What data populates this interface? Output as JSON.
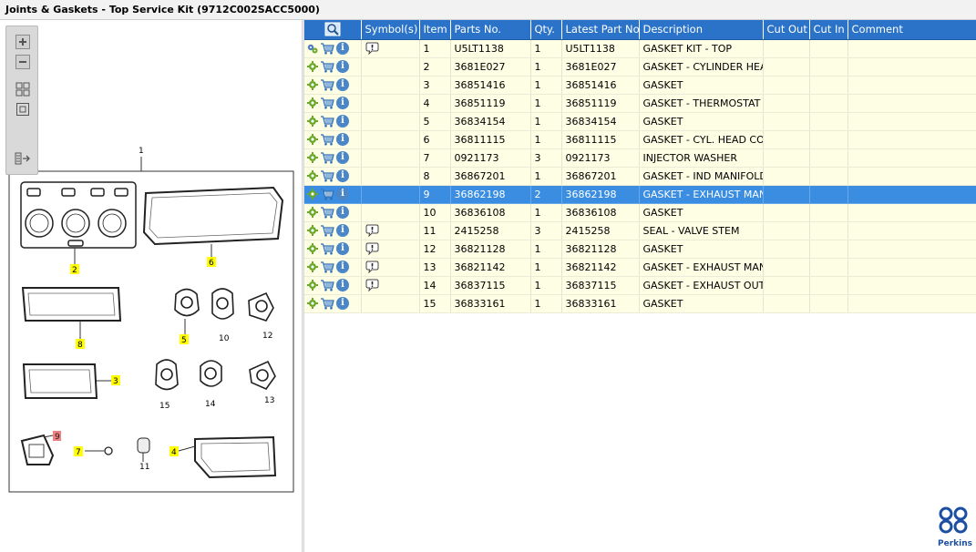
{
  "window": {
    "title": "Joints & Gaskets - Top Service Kit (9712C002SACC5000)"
  },
  "toolbar": {
    "zoom_in": "zoom-in-icon",
    "zoom_out": "zoom-out-icon",
    "fit": "fit-page-icon",
    "actual": "actual-size-icon",
    "panel": "toggle-panel-icon"
  },
  "diagram": {
    "callouts": [
      "1",
      "2",
      "6",
      "8",
      "5",
      "10",
      "12",
      "3",
      "15",
      "14",
      "13",
      "9",
      "7",
      "11",
      "4"
    ],
    "highlight_color": "#ffff00",
    "selected_callout_color": "#f08080"
  },
  "grid": {
    "headers": [
      "",
      "Symbol(s)",
      "Item",
      "Parts No.",
      "Qty.",
      "Latest Part No.",
      "Description",
      "Cut Out",
      "Cut In",
      "Comment"
    ],
    "rows": [
      {
        "item": "1",
        "part": "U5LT1138",
        "qty": "1",
        "latest": "U5LT1138",
        "desc": "GASKET KIT - TOP",
        "sym": true,
        "gearset": true
      },
      {
        "item": "2",
        "part": "3681E027",
        "qty": "1",
        "latest": "3681E027",
        "desc": "GASKET - CYLINDER HEAD",
        "sym": false
      },
      {
        "item": "3",
        "part": "36851416",
        "qty": "1",
        "latest": "36851416",
        "desc": "GASKET",
        "sym": false
      },
      {
        "item": "4",
        "part": "36851119",
        "qty": "1",
        "latest": "36851119",
        "desc": "GASKET - THERMOSTAT HS",
        "sym": false
      },
      {
        "item": "5",
        "part": "36834154",
        "qty": "1",
        "latest": "36834154",
        "desc": "GASKET",
        "sym": false
      },
      {
        "item": "6",
        "part": "36811115",
        "qty": "1",
        "latest": "36811115",
        "desc": "GASKET - CYL. HEAD COVE",
        "sym": false
      },
      {
        "item": "7",
        "part": "0921173",
        "qty": "3",
        "latest": "0921173",
        "desc": "INJECTOR WASHER",
        "sym": false
      },
      {
        "item": "8",
        "part": "36867201",
        "qty": "1",
        "latest": "36867201",
        "desc": "GASKET - IND MANIFOLD",
        "sym": false
      },
      {
        "item": "9",
        "part": "36862198",
        "qty": "2",
        "latest": "36862198",
        "desc": "GASKET - EXHAUST MANIF",
        "sym": false,
        "selected": true
      },
      {
        "item": "10",
        "part": "36836108",
        "qty": "1",
        "latest": "36836108",
        "desc": "GASKET",
        "sym": false
      },
      {
        "item": "11",
        "part": "2415258",
        "qty": "3",
        "latest": "2415258",
        "desc": "SEAL - VALVE STEM",
        "sym": true
      },
      {
        "item": "12",
        "part": "36821128",
        "qty": "1",
        "latest": "36821128",
        "desc": "GASKET",
        "sym": true
      },
      {
        "item": "13",
        "part": "36821142",
        "qty": "1",
        "latest": "36821142",
        "desc": "GASKET - EXHAUST MANIF",
        "sym": true
      },
      {
        "item": "14",
        "part": "36837115",
        "qty": "1",
        "latest": "36837115",
        "desc": "GASKET - EXHAUST OUTLET",
        "sym": true
      },
      {
        "item": "15",
        "part": "36833161",
        "qty": "1",
        "latest": "36833161",
        "desc": "GASKET",
        "sym": false
      }
    ]
  },
  "brand": {
    "name": "Perkins",
    "color": "#1c4fa1"
  }
}
